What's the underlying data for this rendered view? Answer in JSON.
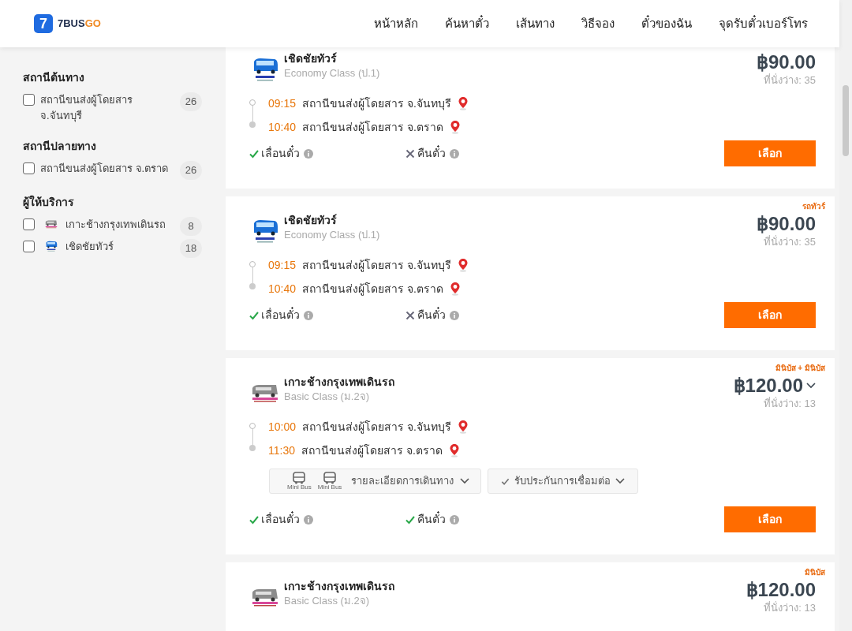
{
  "header": {
    "logo_digit": "7",
    "logo_text_a": "7BUS",
    "logo_text_b": "GO",
    "nav": [
      {
        "label": "หน้าหลัก"
      },
      {
        "label": "ค้นหาตั๋ว"
      },
      {
        "label": "เส้นทาง"
      },
      {
        "label": "วิธีจอง"
      },
      {
        "label": "ตั๋วของฉัน"
      },
      {
        "label": "จุดรับตั๋วเบอร์โทร"
      }
    ]
  },
  "sidebar": {
    "sections": [
      {
        "title": "สถานีต้นทาง",
        "items": [
          {
            "label": "สถานีขนส่งผู้โดยสาร จ.จันทบุรี",
            "count": "26",
            "checked": false
          }
        ]
      },
      {
        "title": "สถานีปลายทาง",
        "items": [
          {
            "label": "สถานีขนส่งผู้โดยสาร จ.ตราด",
            "count": "26",
            "checked": false
          }
        ]
      },
      {
        "title": "ผู้ให้บริการ",
        "items": [
          {
            "label": "เกาะช้างกรุงเทพเดินรถ",
            "count": "8",
            "checked": false,
            "kind": "minibus"
          },
          {
            "label": "เชิดชัยทัวร์",
            "count": "18",
            "checked": false,
            "kind": "coach"
          }
        ]
      }
    ]
  },
  "trips": [
    {
      "operator": "เชิดชัยทัวร์",
      "kind": "coach",
      "class": "Economy Class (ป.1)",
      "price": "฿90.00",
      "seats": "ที่นั่งว่าง: 35",
      "expandable": false,
      "stops": [
        {
          "time": "09:15",
          "station": "สถานีขนส่งผู้โดยสาร จ.จันทบุรี"
        },
        {
          "time": "10:40",
          "station": "สถานีขนส่งผู้โดยสาร จ.ตราด"
        }
      ],
      "features": [
        {
          "label": "เลื่อนตั๋ว",
          "allowed": true
        },
        {
          "label": "คืนตั๋ว",
          "allowed": false
        }
      ],
      "button": "เลือก"
    },
    {
      "tag": "รถทัวร์",
      "operator": "เชิดชัยทัวร์",
      "kind": "coach",
      "class": "Economy Class (ป.1)",
      "price": "฿90.00",
      "seats": "ที่นั่งว่าง: 35",
      "expandable": false,
      "stops": [
        {
          "time": "09:15",
          "station": "สถานีขนส่งผู้โดยสาร จ.จันทบุรี"
        },
        {
          "time": "10:40",
          "station": "สถานีขนส่งผู้โดยสาร จ.ตราด"
        }
      ],
      "features": [
        {
          "label": "เลื่อนตั๋ว",
          "allowed": true
        },
        {
          "label": "คืนตั๋ว",
          "allowed": false
        }
      ],
      "button": "เลือก"
    },
    {
      "tag": "มินิบัส + มินิบัส",
      "operator": "เกาะช้างกรุงเทพเดินรถ",
      "kind": "minibus",
      "class": "Basic Class (ม.2จ)",
      "price": "฿120.00",
      "seats": "ที่นั่งว่าง: 13",
      "expandable": true,
      "stops": [
        {
          "time": "10:00",
          "station": "สถานีขนส่งผู้โดยสาร จ.จันทบุรี"
        },
        {
          "time": "11:30",
          "station": "สถานีขนส่งผู้โดยสาร จ.ตราด"
        }
      ],
      "details": {
        "vehicles": [
          "Mini Bus",
          "Mini Bus"
        ],
        "label": "รายละเอียดการเดินทาง",
        "guarantee": "รับประกันการเชื่อมต่อ"
      },
      "features": [
        {
          "label": "เลื่อนตั๋ว",
          "allowed": true
        },
        {
          "label": "คืนตั๋ว",
          "allowed": true
        }
      ],
      "button": "เลือก"
    },
    {
      "tag": "มินิบัส",
      "operator": "เกาะช้างกรุงเทพเดินรถ",
      "kind": "minibus",
      "class": "Basic Class (ม.2จ)",
      "price": "฿120.00",
      "seats": "ที่นั่งว่าง: 13",
      "expandable": false
    }
  ]
}
